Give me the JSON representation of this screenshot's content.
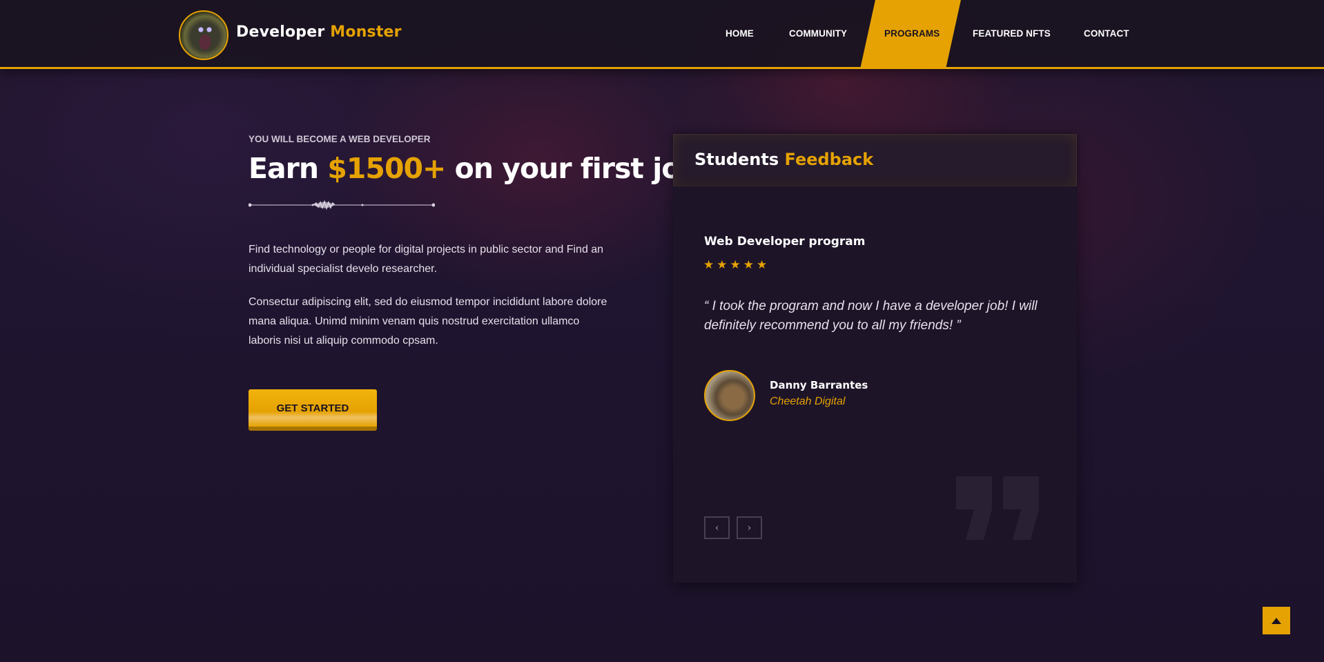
{
  "header": {
    "brand_first": "Developer",
    "brand_second": "Monster",
    "nav": [
      {
        "label": "HOME"
      },
      {
        "label": "COMMUNITY"
      },
      {
        "label": "PROGRAMS",
        "active": true
      },
      {
        "label": "FEATURED NFTS"
      },
      {
        "label": "CONTACT"
      }
    ],
    "accent_color": "#e5a202"
  },
  "hero": {
    "eyebrow": "YOU WILL BECOME A WEB DEVELOPER",
    "headline_pre": "Earn",
    "headline_accent": "$1500+",
    "headline_post": "on your first job",
    "paragraph_1": "Find technology or people for digital projects in public sector and Find an individual specialist develo researcher.",
    "paragraph_2": "Consectur adipiscing elit, sed do eiusmod tempor incididunt labore dolore mana aliqua. Unimd minim venam quis nostrud exercitation ullamco laboris nisi ut aliquip commodo cpsam.",
    "cta_label": "GET STARTED"
  },
  "feedback": {
    "title_first": "Students",
    "title_accent": "Feedback",
    "program": "Web Developer program",
    "rating": 5,
    "quote": "“ I took the program and now I have a developer job! I will definitely recommend you to all my friends! ”",
    "author": "Danny Barrantes",
    "company": "Cheetah Digital",
    "prev_icon": "chevron-left-icon",
    "next_icon": "chevron-right-icon"
  },
  "scroll_top_icon": "triangle-up-icon"
}
